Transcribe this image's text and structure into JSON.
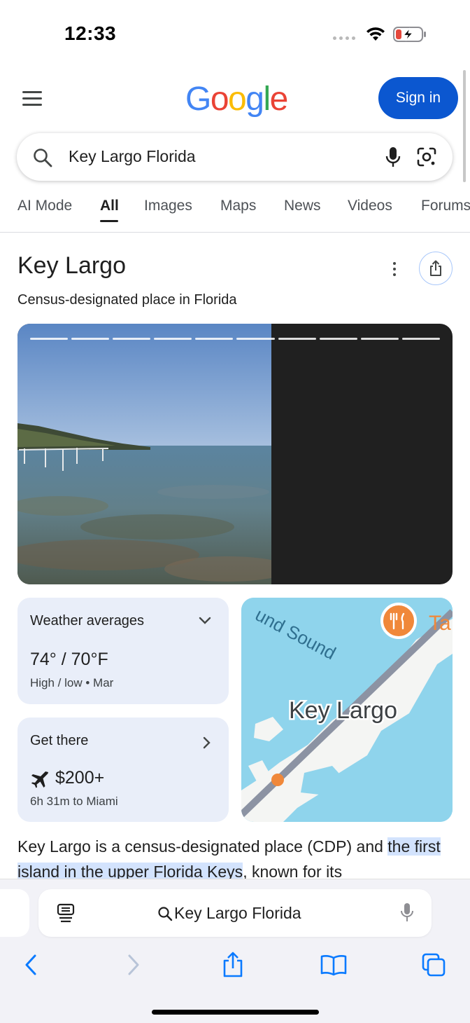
{
  "status_bar": {
    "time": "12:33"
  },
  "header": {
    "logo": [
      "G",
      "o",
      "o",
      "g",
      "l",
      "e"
    ],
    "sign_in": "Sign in"
  },
  "search": {
    "query": "Key Largo Florida"
  },
  "tabs": [
    "AI Mode",
    "All",
    "Images",
    "Maps",
    "News",
    "Videos",
    "Forums"
  ],
  "active_tab": "All",
  "knowledge_panel": {
    "title": "Key Largo",
    "subtitle": "Census-designated place in Florida",
    "media_segments": 10
  },
  "weather": {
    "title": "Weather averages",
    "temps": "74° / 70°F",
    "detail": "High / low • Mar"
  },
  "route": {
    "title": "Get there",
    "price": "$200+",
    "detail": "6h 31m to Miami"
  },
  "map": {
    "place_label": "Key Largo",
    "water_label": "und Sound",
    "partial_label": "Ta"
  },
  "description": {
    "part1": "Key Largo is a census-designated place (CDP) and ",
    "highlight": "the first island in the upper Florida Keys",
    "part2": ", known for its"
  },
  "browser": {
    "address": "Key Largo Florida"
  },
  "colors": {
    "accent": "#0b57d0",
    "card_bg": "#e9eef9",
    "highlight": "#d3e3fd"
  }
}
